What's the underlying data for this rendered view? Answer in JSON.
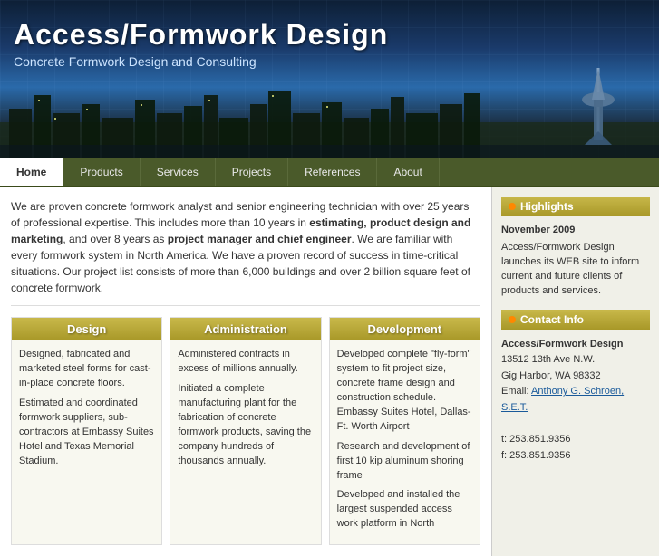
{
  "header": {
    "title": "Access/Formwork Design",
    "subtitle": "Concrete Formwork Design and Consulting"
  },
  "nav": {
    "items": [
      {
        "label": "Home",
        "active": true
      },
      {
        "label": "Products"
      },
      {
        "label": "Services"
      },
      {
        "label": "Projects"
      },
      {
        "label": "References"
      },
      {
        "label": "About"
      }
    ]
  },
  "intro": {
    "text1": "We are proven concrete formwork analyst and senior engineering technician with over 25 years of professional expertise. This includes more than 10 years in ",
    "bold1": "estimating, product design and marketing",
    "text2": ", and over 8 years as ",
    "bold2": "project manager and chief engineer",
    "text3": ". We are familiar with every formwork system in North America. We have a proven record of success in time-critical situations. Our project list consists of more than 6,000 buildings and over 2 billion square feet of concrete formwork."
  },
  "columns": [
    {
      "header": "Design",
      "paragraphs": [
        "Designed, fabricated and marketed steel forms for cast-in-place concrete floors.",
        "Estimated and coordinated formwork suppliers, sub-contractors at Embassy Suites Hotel and Texas Memorial Stadium."
      ]
    },
    {
      "header": "Administration",
      "paragraphs": [
        "Administered contracts in excess of millions annually.",
        "Initiated a complete manufacturing plant for the fabrication of concrete formwork products, saving the company hundreds of thousands annually."
      ]
    },
    {
      "header": "Development",
      "paragraphs": [
        "Developed complete \"fly-form\" system to fit project size, concrete frame design and construction schedule. Embassy Suites Hotel, Dallas-Ft. Worth Airport",
        "Research and development of first 10 kip aluminum shoring frame",
        "Developed and installed the largest suspended access work platform in North"
      ]
    }
  ],
  "sidebar": {
    "highlights_title": "Highlights",
    "highlights_dot": "●",
    "highlight_date": "November 2009",
    "highlight_text": "Access/Formwork Design launches its WEB site to inform current and future clients of products and services.",
    "contact_title": "Contact Info",
    "contact_dot": "●",
    "company": "Access/Formwork Design",
    "address1": "13512 13th Ave N.W.",
    "address2": "Gig Harbor, WA 98332",
    "email_label": "Email: ",
    "email_link": "Anthony G. Schroen, S.E.T.",
    "phone1": "t: 253.851.9356",
    "phone2": "f: 253.851.9356"
  }
}
